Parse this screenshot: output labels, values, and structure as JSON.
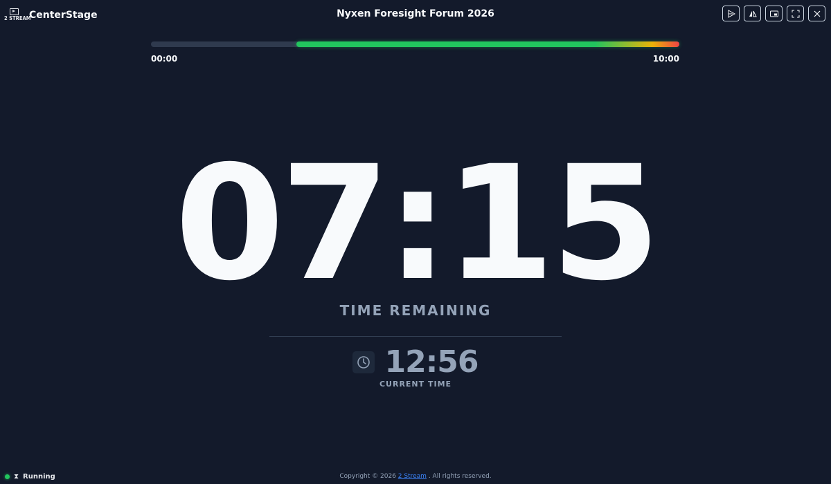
{
  "app": {
    "logo_text": "2 STREAM",
    "name": "CenterStage"
  },
  "event": {
    "title": "Nyxen Foresight Forum 2026"
  },
  "toolbar": {
    "buttons": [
      {
        "icon": "send-message-icon"
      },
      {
        "icon": "flip-mirror-icon"
      },
      {
        "icon": "picture-in-picture-icon"
      },
      {
        "icon": "fullscreen-icon"
      },
      {
        "icon": "close-icon"
      }
    ]
  },
  "progress": {
    "start_label": "00:00",
    "end_label": "10:00",
    "remaining_fraction": 0.725
  },
  "timer": {
    "countdown": "07:15",
    "label": "TIME REMAINING"
  },
  "clock": {
    "current_time": "12:56",
    "label": "CURRENT TIME",
    "icon": "clock-icon"
  },
  "status": {
    "text": "Running",
    "icon": "hourglass-icon",
    "color": "#22c55e"
  },
  "footer": {
    "prefix": "Copyright © 2026",
    "link_text": "2 Stream",
    "suffix": ". All rights reserved."
  },
  "colors": {
    "background": "#131a2b",
    "progress_green": "#22c55e",
    "progress_yellow": "#eab308",
    "progress_red": "#ef4444",
    "muted_text": "#94a3b8"
  }
}
